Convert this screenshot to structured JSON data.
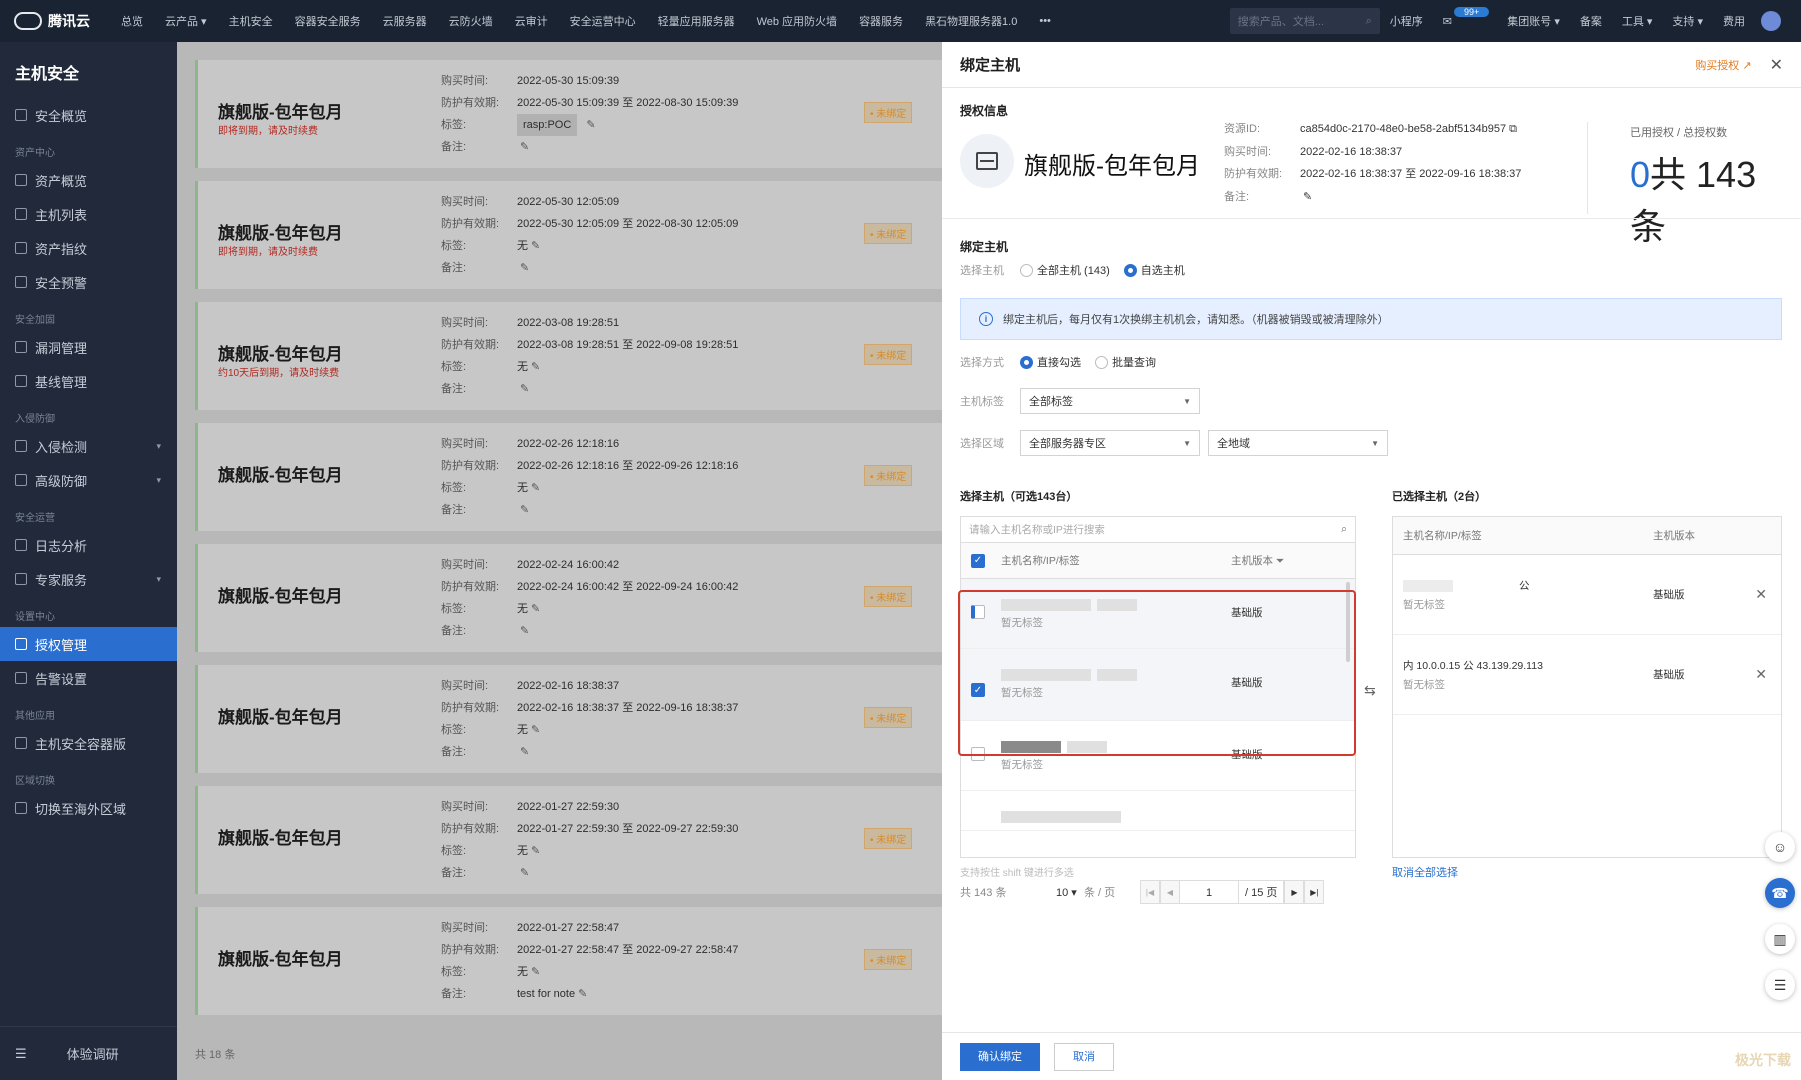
{
  "topbar": {
    "logo": "腾讯云",
    "nav": [
      "总览",
      "云产品 ▾",
      "主机安全",
      "容器安全服务",
      "云服务器",
      "云防火墙",
      "云审计",
      "安全运营中心",
      "轻量应用服务器",
      "Web 应用防火墙",
      "容器服务",
      "黑石物理服务器1.0",
      "•••"
    ],
    "search_placeholder": "搜索产品、文档...",
    "right": [
      "小程序",
      "集团账号 ▾",
      "备案",
      "工具 ▾",
      "支持 ▾",
      "费用"
    ],
    "badge": "99+"
  },
  "sidebar": {
    "title": "主机安全",
    "groups": [
      {
        "title": "",
        "items": [
          {
            "label": "安全概览",
            "icon": "dashboard-icon"
          }
        ]
      },
      {
        "title": "资产中心",
        "items": [
          {
            "label": "资产概览",
            "icon": "monitor-icon"
          },
          {
            "label": "主机列表",
            "icon": "list-icon"
          },
          {
            "label": "资产指纹",
            "icon": "fingerprint-icon"
          },
          {
            "label": "安全预警",
            "icon": "shield-icon"
          }
        ]
      },
      {
        "title": "安全加固",
        "items": [
          {
            "label": "漏洞管理",
            "icon": "bug-icon"
          },
          {
            "label": "基线管理",
            "icon": "cube-icon"
          }
        ]
      },
      {
        "title": "入侵防御",
        "items": [
          {
            "label": "入侵检测",
            "icon": "cube-icon",
            "expand": true
          },
          {
            "label": "高级防御",
            "icon": "shield-icon",
            "expand": true
          }
        ]
      },
      {
        "title": "安全运营",
        "items": [
          {
            "label": "日志分析",
            "icon": "log-icon"
          },
          {
            "label": "专家服务",
            "icon": "user-icon",
            "expand": true
          }
        ]
      },
      {
        "title": "设置中心",
        "items": [
          {
            "label": "授权管理",
            "icon": "gear-icon",
            "active": true
          },
          {
            "label": "告警设置",
            "icon": "bell-icon"
          }
        ]
      },
      {
        "title": "其他应用",
        "items": [
          {
            "label": "主机安全容器版",
            "icon": "shield-icon"
          }
        ]
      },
      {
        "title": "区域切换",
        "items": [
          {
            "label": "切换至海外区域",
            "icon": "switch-icon"
          }
        ]
      }
    ],
    "bottom_label": "体验调研"
  },
  "licenses": [
    {
      "title": "旗舰版-包年包月",
      "warn": "即将到期，请及时续费",
      "buy_time": "2022-05-30 15:09:39",
      "period": "2022-05-30 15:09:39 至 2022-08-30 15:09:39",
      "tag": "rasp:POC",
      "note": "",
      "status": "未绑定"
    },
    {
      "title": "旗舰版-包年包月",
      "warn": "即将到期，请及时续费",
      "buy_time": "2022-05-30 12:05:09",
      "period": "2022-05-30 12:05:09 至 2022-08-30 12:05:09",
      "tag": "无",
      "note": "",
      "status": "未绑定"
    },
    {
      "title": "旗舰版-包年包月",
      "warn": "约10天后到期，请及时续费",
      "buy_time": "2022-03-08 19:28:51",
      "period": "2022-03-08 19:28:51 至 2022-09-08 19:28:51",
      "tag": "无",
      "note": "",
      "status": "未绑定"
    },
    {
      "title": "旗舰版-包年包月",
      "warn": "",
      "buy_time": "2022-02-26 12:18:16",
      "period": "2022-02-26 12:18:16 至 2022-09-26 12:18:16",
      "tag": "无",
      "note": "",
      "status": "未绑定"
    },
    {
      "title": "旗舰版-包年包月",
      "warn": "",
      "buy_time": "2022-02-24 16:00:42",
      "period": "2022-02-24 16:00:42 至 2022-09-24 16:00:42",
      "tag": "无",
      "note": "",
      "status": "未绑定"
    },
    {
      "title": "旗舰版-包年包月",
      "warn": "",
      "buy_time": "2022-02-16 18:38:37",
      "period": "2022-02-16 18:38:37 至 2022-09-16 18:38:37",
      "tag": "无",
      "note": "",
      "status": "未绑定"
    },
    {
      "title": "旗舰版-包年包月",
      "warn": "",
      "buy_time": "2022-01-27 22:59:30",
      "period": "2022-01-27 22:59:30 至 2022-09-27 22:59:30",
      "tag": "无",
      "note": "",
      "status": "未绑定"
    },
    {
      "title": "旗舰版-包年包月",
      "warn": "",
      "buy_time": "2022-01-27 22:58:47",
      "period": "2022-01-27 22:58:47 至 2022-09-27 22:58:47",
      "tag": "无",
      "note": "test for note",
      "status": "未绑定"
    }
  ],
  "card_labels": {
    "buy_time": "购买时间:",
    "period": "防护有效期:",
    "tag": "标签:",
    "note": "备注:"
  },
  "content_footer": "共 18 条",
  "drawer": {
    "title": "绑定主机",
    "buy_link": "购买授权",
    "auth_section": "授权信息",
    "license_name": "旗舰版-包年包月",
    "fields": [
      {
        "label": "资源ID:",
        "value": "ca854d0c-2170-48e0-be58-2abf5134b957"
      },
      {
        "label": "购买时间:",
        "value": "2022-02-16 18:38:37"
      },
      {
        "label": "防护有效期:",
        "value": "2022-02-16 18:38:37 至 2022-09-16 18:38:37"
      },
      {
        "label": "备注:",
        "value": ""
      }
    ],
    "usage_label": "已用授权 / 总授权数",
    "used": "0",
    "total": "共 143 条",
    "bind_section": "绑定主机",
    "select_host_label": "选择主机",
    "host_options": [
      "全部主机 (143)",
      "自选主机"
    ],
    "host_option_selected": 1,
    "info_text": "绑定主机后，每月仅有1次换绑主机机会，请知悉。（机器被销毁或被清理除外）",
    "method_label": "选择方式",
    "method_options": [
      "直接勾选",
      "批量查询"
    ],
    "method_selected": 0,
    "tag_label": "主机标签",
    "tag_value": "全部标签",
    "region_label": "选择区域",
    "region_value_1": "全部服务器专区",
    "region_value_2": "全地域",
    "left_title": "选择主机（可选143台）",
    "search_placeholder": "请输入主机名称或IP进行搜索",
    "col_name": "主机名称/IP/标签",
    "col_version": "主机版本",
    "left_rows": [
      {
        "checked": "partial",
        "sub": "暂无标签",
        "version": "基础版"
      },
      {
        "checked": true,
        "sub": "暂无标签",
        "version": "基础版"
      },
      {
        "checked": false,
        "sub": "暂无标签",
        "version": "基础版"
      }
    ],
    "hint": "支持按住 shift 键进行多选",
    "page_size": "10 ▾",
    "page_size_unit": "条 / 页",
    "page": "1",
    "pages": "/ 15 页",
    "right_title": "已选择主机（2台）",
    "right_rows": [
      {
        "name_suffix": "公",
        "sub": "暂无标签",
        "version": "基础版"
      },
      {
        "name": "内 10.0.0.15   公 43.139.29.113",
        "sub": "暂无标签",
        "version": "基础版"
      }
    ],
    "cancel_all": "取消全部选择",
    "confirm": "确认绑定",
    "cancel": "取消"
  },
  "watermark": "极光下载"
}
